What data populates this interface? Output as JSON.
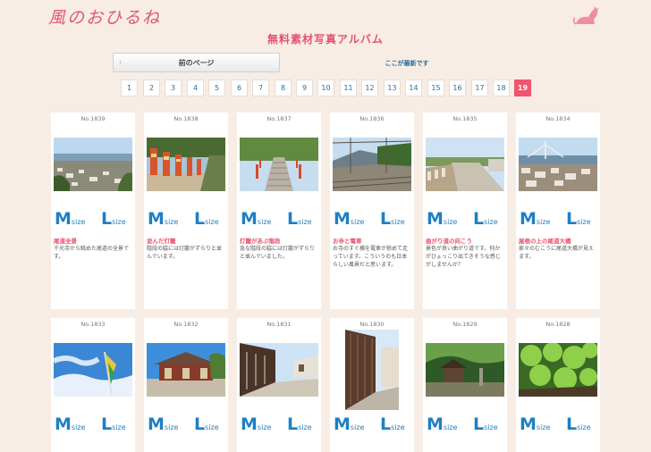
{
  "site": {
    "logo_text": "風のおひるね",
    "title": "無料素材写真アルバム"
  },
  "nav": {
    "prev_label": "前のページ",
    "latest_label": "ここが最新です"
  },
  "pagination": {
    "pages": [
      "1",
      "2",
      "3",
      "4",
      "5",
      "6",
      "7",
      "8",
      "9",
      "10",
      "11",
      "12",
      "13",
      "14",
      "15",
      "16",
      "17",
      "18",
      "19"
    ],
    "current": "19"
  },
  "size_labels": {
    "m_big": "M",
    "m_small": "size",
    "l_big": "L",
    "l_small": "size"
  },
  "cards": [
    {
      "num": "No.1839",
      "title": "尾道全景",
      "desc": "千光寺から眺めた尾道の全景です。",
      "scene": "town"
    },
    {
      "num": "No.1838",
      "title": "並んだ灯籠",
      "desc": "階段の脇には灯籠がずらりと並んでいます。",
      "scene": "lanterns"
    },
    {
      "num": "No.1837",
      "title": "灯籠があぶ階段",
      "desc": "急な階段の脇には灯籠がずらりと並んでいました。",
      "scene": "stairs"
    },
    {
      "num": "No.1836",
      "title": "お寺と電車",
      "desc": "お寺のすぐ横を電車が掠めて走っています。こういうのも日本らしい風景だと思います。",
      "scene": "train"
    },
    {
      "num": "No.1835",
      "title": "曲がり道の向こう",
      "desc": "景色が良い曲がり道です。何かがひょっこり出てきそうな感じがしませんか？",
      "scene": "road"
    },
    {
      "num": "No.1834",
      "title": "屋根の上の尾道大橋",
      "desc": "家々のむこうに尾道大橋が見えます。",
      "scene": "bridge"
    },
    {
      "num": "No.1833",
      "title": "",
      "desc": "",
      "scene": "flag"
    },
    {
      "num": "No.1832",
      "title": "",
      "desc": "",
      "scene": "temple"
    },
    {
      "num": "No.1831",
      "title": "",
      "desc": "",
      "scene": "alley"
    },
    {
      "num": "No.1830",
      "title": "",
      "desc": "",
      "scene": "wall"
    },
    {
      "num": "No.1829",
      "title": "",
      "desc": "",
      "scene": "shrine"
    },
    {
      "num": "No.1828",
      "title": "",
      "desc": "",
      "scene": "leaves"
    }
  ]
}
